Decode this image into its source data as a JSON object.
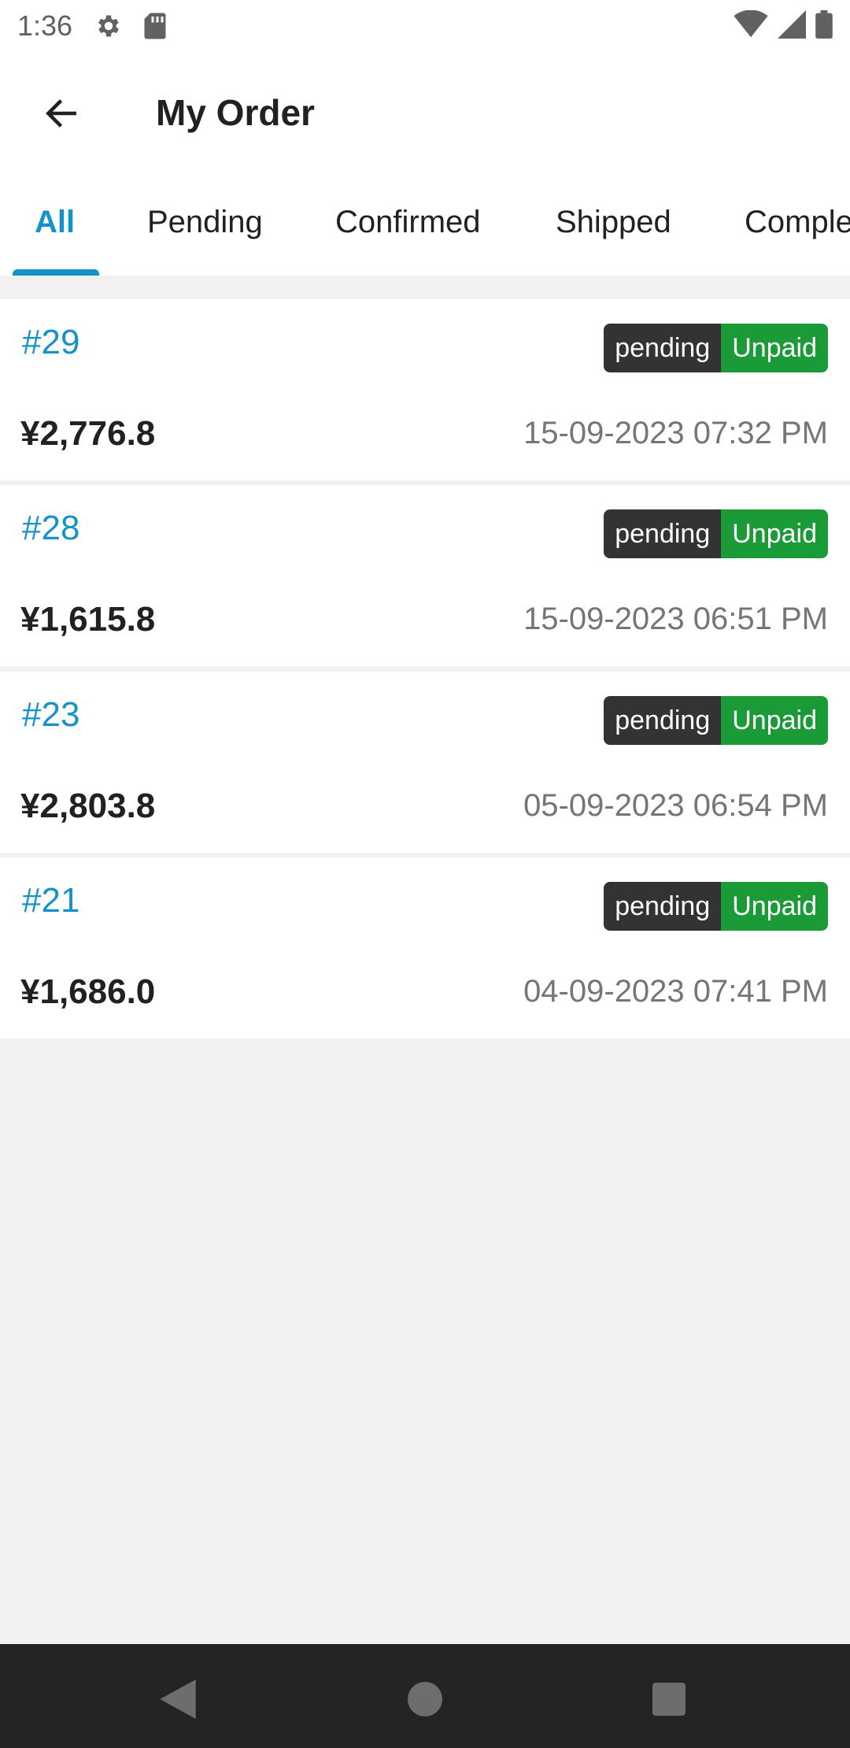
{
  "status_bar": {
    "time": "1:36",
    "icons": [
      "gear-icon",
      "sd-card-icon",
      "wifi-icon",
      "signal-icon",
      "battery-icon"
    ]
  },
  "header": {
    "title": "My Order",
    "back_icon": "arrow-left-icon"
  },
  "tabs": [
    {
      "label": "All",
      "active": true
    },
    {
      "label": "Pending",
      "active": false
    },
    {
      "label": "Confirmed",
      "active": false
    },
    {
      "label": "Shipped",
      "active": false
    },
    {
      "label": "Completed",
      "active": false
    }
  ],
  "orders": [
    {
      "id": "#29",
      "status": "pending",
      "payment": "Unpaid",
      "amount": "¥2,776.8",
      "date": "15-09-2023 07:32 PM"
    },
    {
      "id": "#28",
      "status": "pending",
      "payment": "Unpaid",
      "amount": "¥1,615.8",
      "date": "15-09-2023 06:51 PM"
    },
    {
      "id": "#23",
      "status": "pending",
      "payment": "Unpaid",
      "amount": "¥2,803.8",
      "date": "05-09-2023 06:54 PM"
    },
    {
      "id": "#21",
      "status": "pending",
      "payment": "Unpaid",
      "amount": "¥1,686.0",
      "date": "04-09-2023 07:41 PM"
    }
  ],
  "colors": {
    "accent": "#1592c9",
    "status_badge": "#333333",
    "payment_badge": "#1a9b37"
  },
  "nav_bar": {
    "icons": [
      "back-triangle-icon",
      "home-circle-icon",
      "recents-square-icon"
    ]
  }
}
